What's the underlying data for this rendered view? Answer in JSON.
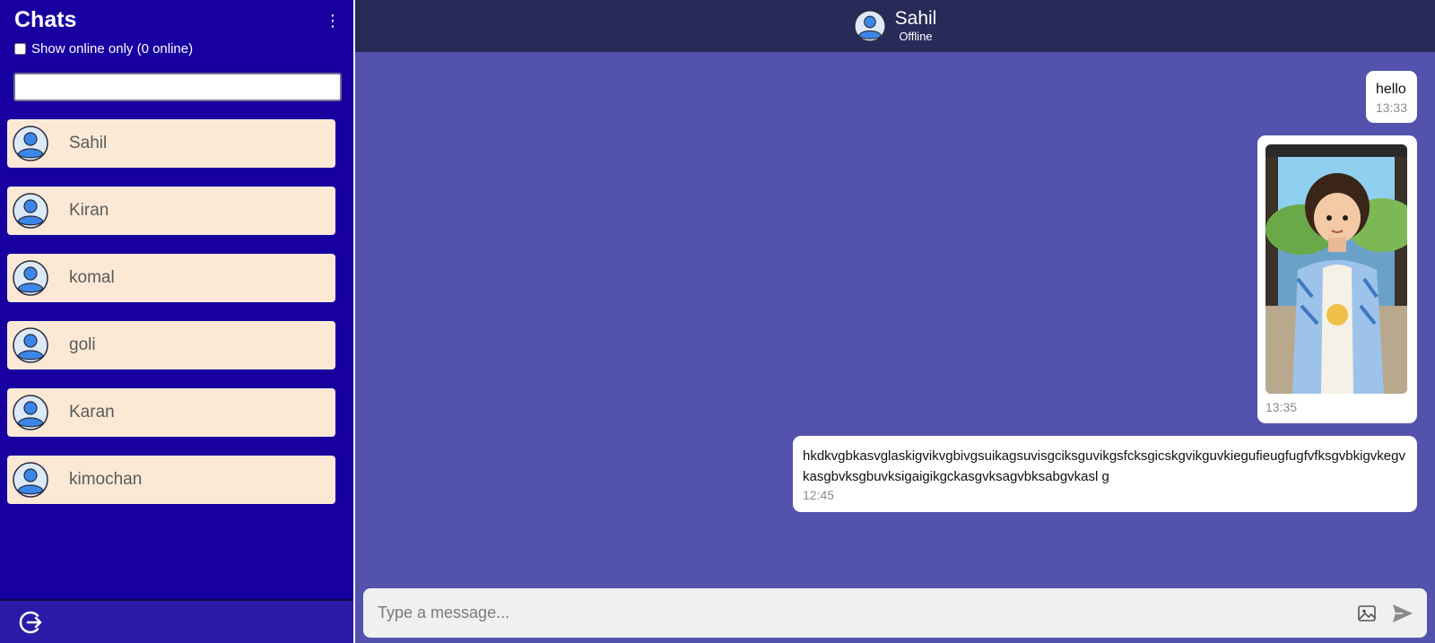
{
  "sidebar": {
    "title": "Chats",
    "menu_icon": "kebab-menu-icon",
    "online_filter_label": "Show online only (0 online)",
    "online_filter_checked": false,
    "search_value": "",
    "contacts": [
      {
        "name": "Sahil"
      },
      {
        "name": "Kiran"
      },
      {
        "name": "komal"
      },
      {
        "name": "goli"
      },
      {
        "name": "Karan"
      },
      {
        "name": "kimochan"
      }
    ],
    "logout_icon": "logout-icon"
  },
  "chat": {
    "contact_name": "Sahil",
    "contact_status": "Offline",
    "messages": [
      {
        "type": "text",
        "text": "hello",
        "time": "13:33"
      },
      {
        "type": "image",
        "time": "13:35"
      },
      {
        "type": "text",
        "text": "hkdkvgbkasvglaskigvikvgbivgsuikagsuvisgciksguvikgsfcksgicskgvikguvkiegufieugfugfvfksgvbkigvkegvkasgbvksgbuvksigaigikgckasgvksagvbksabgvkasl g",
        "time": "12:45"
      }
    ],
    "composer": {
      "placeholder": "Type a message...",
      "value": "",
      "image_icon": "image-icon",
      "send_icon": "send-icon"
    }
  },
  "colors": {
    "sidebar_bg": "#1800a0",
    "contact_bg": "#fbe9d6",
    "chat_bg": "#5353ad",
    "header_bg": "#282a58",
    "bubble_bg": "#ffffff"
  }
}
